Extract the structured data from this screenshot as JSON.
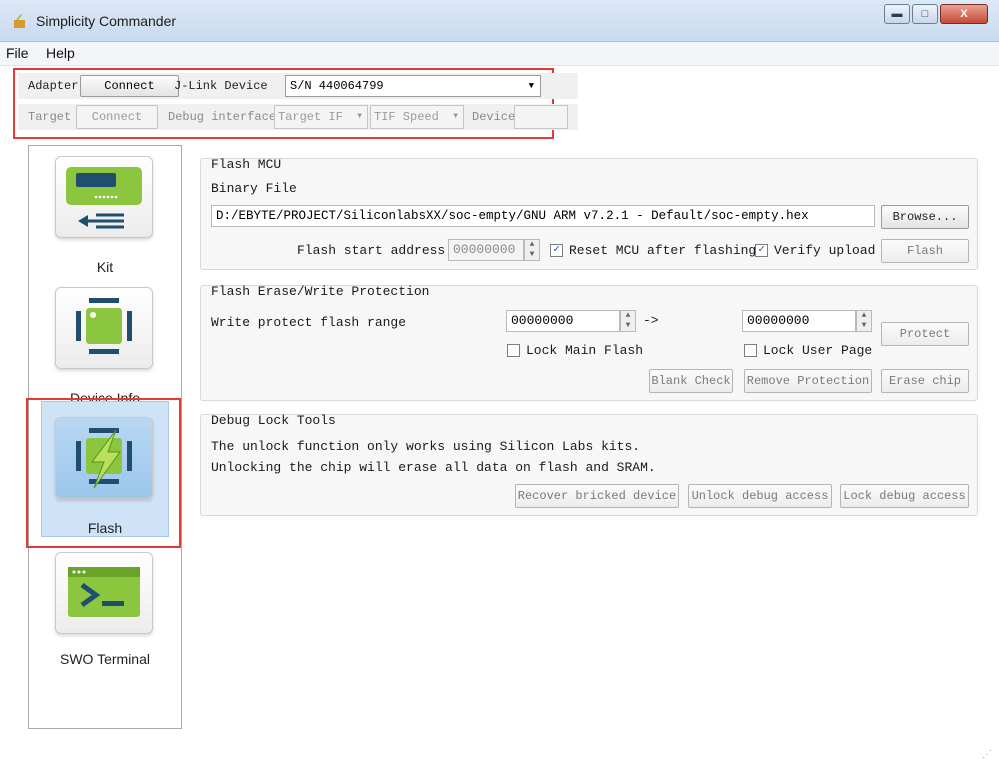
{
  "window": {
    "title": "Simplicity Commander",
    "controls": [
      "minimize",
      "maximize",
      "close"
    ],
    "minimize_glyph": "▬",
    "maximize_glyph": "□",
    "close_glyph": "X"
  },
  "menu": [
    "File",
    "Help"
  ],
  "adapter_bar": {
    "adapter_label": "Adapter",
    "connect_label": "Connect",
    "jlink_label": "J-Link Device",
    "device_value": "S/N 440064799"
  },
  "target_bar": {
    "target_label": "Target",
    "connect_label": "Connect",
    "debug_interface_label": "Debug interface",
    "target_if_value": "Target IF",
    "tif_speed_value": "TIF Speed",
    "device_label": "Device"
  },
  "sidebar": {
    "items": [
      {
        "label": "Kit",
        "icon": "kit-icon"
      },
      {
        "label": "Device Info",
        "icon": "chip-icon"
      },
      {
        "label": "Flash",
        "icon": "flash-chip-icon",
        "selected": true
      },
      {
        "label": "SWO Terminal",
        "icon": "terminal-icon"
      }
    ]
  },
  "flash_mcu": {
    "title": "Flash MCU",
    "binary_file_label": "Binary File",
    "binary_file_path": "D:/EBYTE/PROJECT/SiliconlabsXX/soc-empty/GNU ARM v7.2.1 - Default/soc-empty.hex",
    "browse_label": "Browse...",
    "start_address_label": "Flash start address:",
    "start_address_value": "00000000",
    "reset_label": "Reset MCU after flashing",
    "reset_checked": true,
    "verify_label": "Verify upload",
    "verify_checked": true,
    "flash_button": "Flash"
  },
  "erase_protect": {
    "title": "Flash Erase/Write Protection",
    "range_label": "Write protect flash range",
    "range_start": "00000000",
    "arrow": "->",
    "range_end": "00000000",
    "protect_button": "Protect",
    "lock_main_label": "Lock Main Flash",
    "lock_user_label": "Lock User Page",
    "blank_check": "Blank Check",
    "remove_protection": "Remove Protection",
    "erase_chip": "Erase chip"
  },
  "debug_lock": {
    "title": "Debug Lock Tools",
    "line1": "The unlock function only works using Silicon Labs kits.",
    "line2": "Unlocking the chip will erase all data on flash and SRAM.",
    "recover": "Recover bricked device",
    "unlock": "Unlock debug access",
    "lock": "Lock debug access"
  },
  "colors": {
    "highlight_box": "#e53935",
    "selected_nav": "#cfe3f6",
    "icon_green": "#8cc63e"
  }
}
